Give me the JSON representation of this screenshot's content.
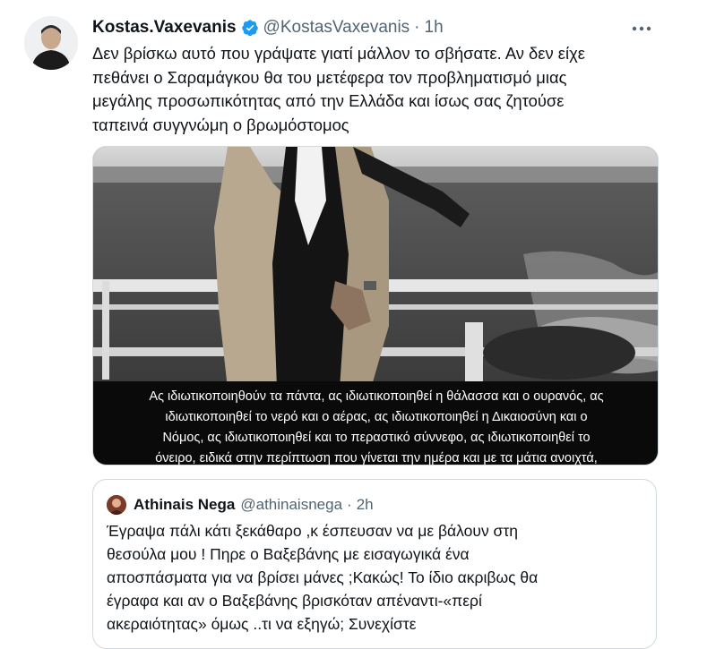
{
  "tweet": {
    "author_name": "Kostas.Vaxevanis",
    "handle": "@KostasVaxevanis",
    "separator": "·",
    "time": "1h",
    "verified_color": "#1d9bf0",
    "text_lines": [
      "Δεν βρίσκω αυτό που γράψατε γιατί μάλλον το σβήσατε. Αν δεν είχε",
      "πεθάνει ο Σαραμάγκου θα του μετέφερα τον προβληματισμό μιας",
      "μεγάλης προσωπικότητας από την Ελλάδα και ίσως σας ζητούσε",
      "ταπεινά συγγνώμη ο βρωμόστομος"
    ],
    "icons": [
      "verified-badge-icon",
      "more-icon"
    ]
  },
  "media": {
    "caption_lines": [
      "Ας ιδιωτικοποιηθούν τα πάντα, ας ιδιωτικοποιηθεί η θάλασσα και ο ουρανός, ας",
      "ιδιωτικοποιηθεί το νερό και ο αέρας, ας ιδιωτικοποιηθεί η Δικαιοσύνη και ο",
      "Νόμος, ας ιδιωτικοποιηθεί και το περαστικό σύννεφο, ας ιδιωτικοποιηθεί το",
      "όνειρο, ειδικά στην περίπτωση που γίνεται την ημέρα και με τα μάτια ανοιχτά,"
    ]
  },
  "quote": {
    "author_name": "Athinais Nega",
    "handle": "@athinaisnega",
    "separator": "·",
    "time": "2h",
    "text_lines": [
      "Έγραψα πάλι κάτι ξεκάθαρο ,κ έσπευσαν να με βάλουν στη",
      "θεσούλα μου ! Πηρε ο Βαξεβάνης με εισαγωγικά ένα",
      "αποσπάσματα για να βρίσει μάνες ;Κακώς! Το ίδιο ακριβως θα",
      "έγραφα και αν ο Βαξεβάνης βρισκόταν απέναντι-«περί",
      "ακεραιότητας» όμως ..τι να εξηγώ; Συνεχίστε"
    ]
  }
}
